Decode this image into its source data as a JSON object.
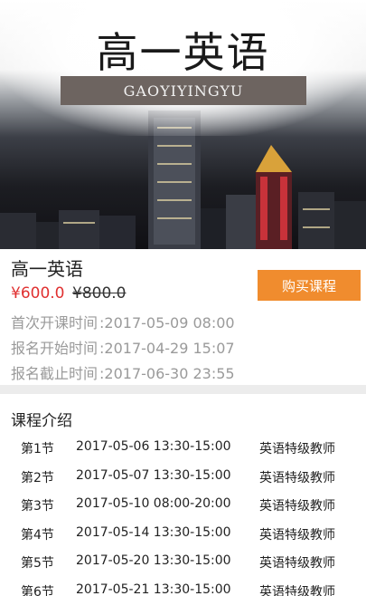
{
  "banner": {
    "title": "高一英语",
    "subtitle": "GAOYIYINGYU"
  },
  "course": {
    "title": "高一英语",
    "price_current": "¥600.0",
    "price_original": "¥800.0",
    "buy_label": "购买课程",
    "meta": [
      {
        "label": "首次开课时间",
        "value": ":2017-05-09 08:00"
      },
      {
        "label": "报名开始时间",
        "value": ":2017-04-29 15:07"
      },
      {
        "label": "报名截止时间",
        "value": ":2017-06-30 23:55"
      }
    ]
  },
  "intro": {
    "title": "课程介绍",
    "lessons": [
      {
        "no": "第1节",
        "time": "2017-05-06 13:30-15:00",
        "teacher": "英语特级教师"
      },
      {
        "no": "第2节",
        "time": "2017-05-07 13:30-15:00",
        "teacher": "英语特级教师"
      },
      {
        "no": "第3节",
        "time": "2017-05-10 08:00-20:00",
        "teacher": "英语特级教师"
      },
      {
        "no": "第4节",
        "time": "2017-05-14 13:30-15:00",
        "teacher": "英语特级教师"
      },
      {
        "no": "第5节",
        "time": "2017-05-20 13:30-15:00",
        "teacher": "英语特级教师"
      },
      {
        "no": "第6节",
        "time": "2017-05-21 13:30-15:00",
        "teacher": "英语特级教师"
      }
    ]
  },
  "colors": {
    "accent": "#f08c2e",
    "price": "#e03030",
    "muted": "#9a9a9a"
  }
}
